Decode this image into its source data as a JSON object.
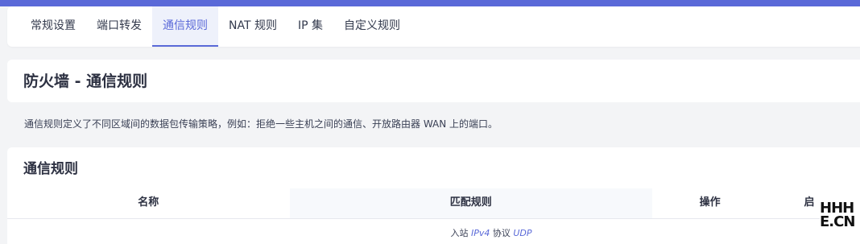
{
  "tabs": [
    {
      "label": "常规设置",
      "active": false
    },
    {
      "label": "端口转发",
      "active": false
    },
    {
      "label": "通信规则",
      "active": true
    },
    {
      "label": "NAT 规则",
      "active": false
    },
    {
      "label": "IP 集",
      "active": false
    },
    {
      "label": "自定义规则",
      "active": false
    }
  ],
  "page": {
    "title": "防火墙 - 通信规则",
    "description": "通信规则定义了不同区域间的数据包传输策略，例如：拒绝一些主机之间的通信、开放路由器 WAN 上的端口。"
  },
  "rules_section": {
    "title": "通信规则",
    "columns": {
      "name": "名称",
      "match": "匹配规则",
      "action": "操作",
      "enable": "启"
    },
    "first_row_match": {
      "prefix": "入站 ",
      "family": "IPv4",
      "mid": " 协议 ",
      "proto": "UDP"
    }
  },
  "watermark": {
    "line1": "HHH",
    "line2": "E.CN"
  },
  "colors": {
    "accent": "#5a69d8",
    "background": "#f3f4f6"
  }
}
